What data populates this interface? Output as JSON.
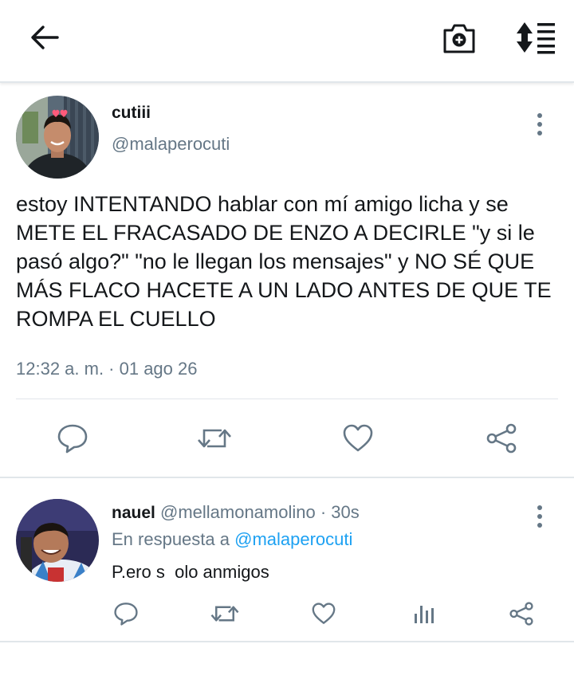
{
  "header": {
    "back_icon": "arrow-left-icon",
    "camera_icon": "camera-plus-icon",
    "sort_icon": "sort-list-icon"
  },
  "tweet": {
    "display_name": "cutiii",
    "handle": "@malaperocuti",
    "text": "estoy INTENTANDO hablar con mí amigo licha y se METE EL FRACASADO DE ENZO A DECIRLE \"y si le pasó algo?\" \"no le llegan los mensajes\" y NO SÉ QUE MÁS FLACO HACETE A UN LADO ANTES DE QUE TE ROMPA EL CUELLO",
    "timestamp": "12:32 a. m. · 01 ago 26",
    "actions": [
      "reply-icon",
      "retweet-icon",
      "like-icon",
      "share-icon"
    ]
  },
  "reply": {
    "display_name": "nauel",
    "handle_time": "@mellamonamolino · 30s",
    "in_reply_prefix": "En respuesta a",
    "in_reply_mention": "@malaperocuti",
    "text": "P.ero s  olo anmigos",
    "actions": [
      "reply-icon",
      "retweet-icon",
      "like-icon",
      "analytics-icon",
      "share-icon"
    ]
  },
  "colors": {
    "text": "#14171a",
    "secondary": "#657786",
    "link": "#1da1f2",
    "divider": "#e1e6ea"
  }
}
